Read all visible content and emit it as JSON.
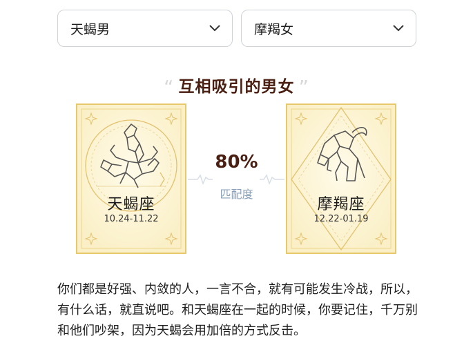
{
  "selects": {
    "left": "天蝎男",
    "right": "摩羯女"
  },
  "section_title": "互相吸引的男女",
  "quote_open": "“",
  "quote_close": "”",
  "left_sign": {
    "name": "天蝎座",
    "dates": "10.24-11.22",
    "icon": "scorpion-icon"
  },
  "right_sign": {
    "name": "摩羯座",
    "dates": "12.22-01.19",
    "icon": "goat-icon"
  },
  "match": {
    "percent": "80%",
    "label": "匹配度"
  },
  "description": "你们都是好强、内敛的人，一言不合，就有可能发生冷战，所以，有什么话，就直说吧。和天蝎座在一起的时候，你要记住，千万别和他们吵架，因为天蝎会用加倍的方式反击。",
  "colors": {
    "gold": "#e7c96b",
    "title_brown": "#4a1f12",
    "label_blue": "#8aa0b8"
  }
}
